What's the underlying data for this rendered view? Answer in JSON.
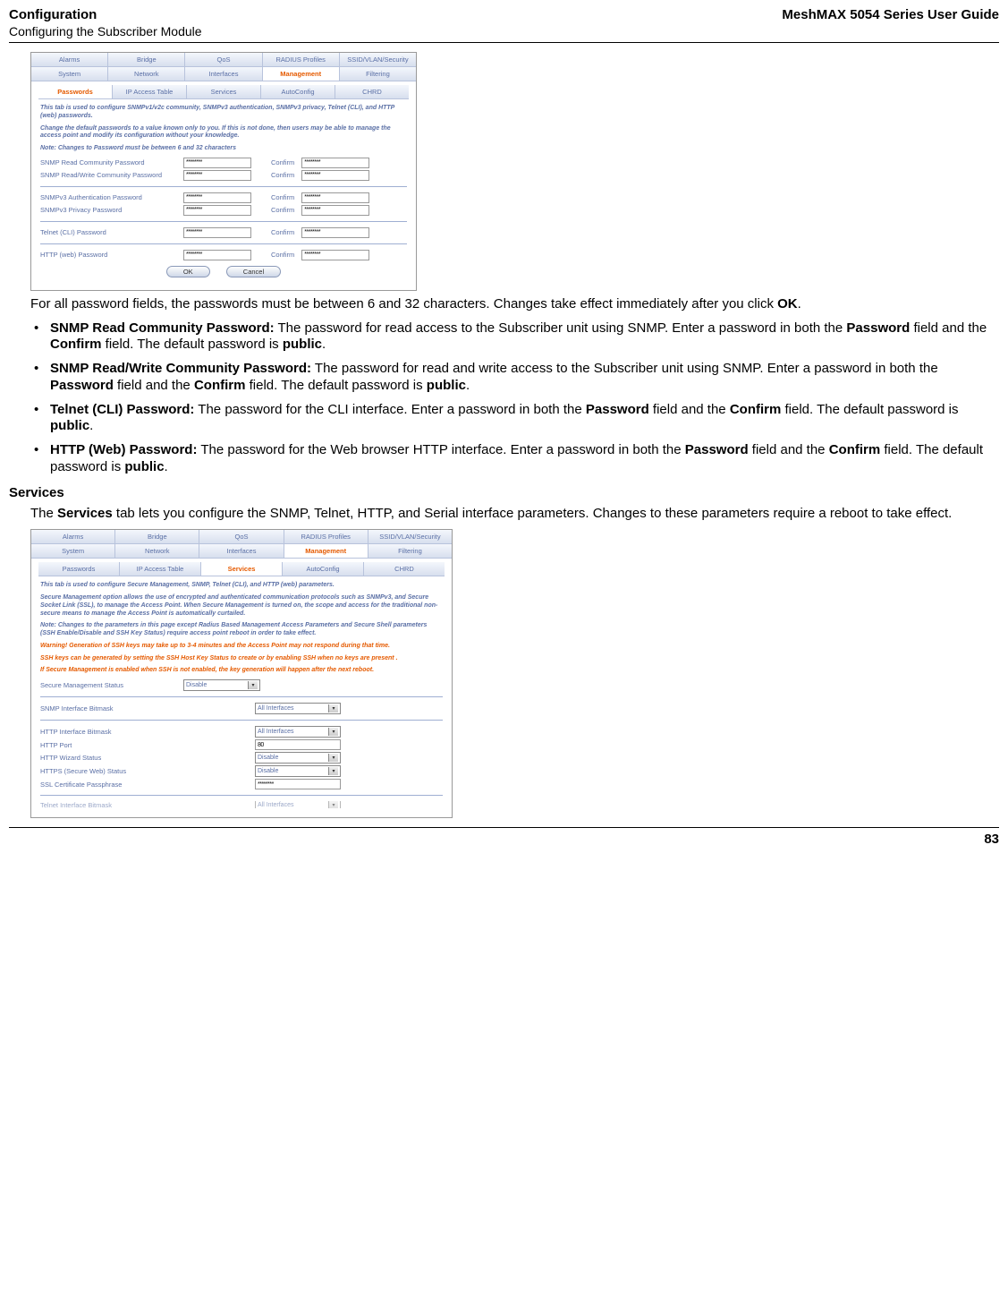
{
  "header": {
    "title_left": "Configuration",
    "sub_left": "Configuring the Subscriber Module",
    "title_right": "MeshMAX 5054 Series User Guide"
  },
  "shot1": {
    "tabs_top": [
      "Alarms",
      "Bridge",
      "QoS",
      "RADIUS Profiles",
      "SSID/VLAN/Security"
    ],
    "tabs_mid": [
      "System",
      "Network",
      "Interfaces",
      "Management",
      "Filtering"
    ],
    "tabs_sub": [
      "Passwords",
      "IP Access Table",
      "Services",
      "AutoConfig",
      "CHRD"
    ],
    "active_mid": "Management",
    "active_sub": "Passwords",
    "desc1": "This tab is used to configure SNMPv1/v2c community, SNMPv3 authentication, SNMPv3 privacy, Telnet (CLI), and HTTP (web) passwords.",
    "desc2": "Change the default passwords to a value known only to you. If this is not done, then users may be able to manage the access point and modify its configuration without your knowledge.",
    "desc3": "Note: Changes to Password must be between 6 and 32 characters",
    "rows": [
      {
        "label": "SNMP Read Community Password",
        "val": "********",
        "confirm": "Confirm",
        "cval": "********"
      },
      {
        "label": "SNMP Read/Write Community Password",
        "val": "********",
        "confirm": "Confirm",
        "cval": "********"
      }
    ],
    "rows2": [
      {
        "label": "SNMPv3 Authentication Password",
        "val": "********",
        "confirm": "Confirm",
        "cval": "********"
      },
      {
        "label": "SNMPv3 Privacy Password",
        "val": "********",
        "confirm": "Confirm",
        "cval": "********"
      }
    ],
    "rows3": [
      {
        "label": "Telnet (CLI) Password",
        "val": "********",
        "confirm": "Confirm",
        "cval": "********"
      }
    ],
    "rows4": [
      {
        "label": "HTTP (web) Password",
        "val": "********",
        "confirm": "Confirm",
        "cval": "********"
      }
    ],
    "ok": "OK",
    "cancel": "Cancel"
  },
  "para1_a": "For all password fields, the passwords must be between 6 and 32 characters. Changes take effect immediately after you click ",
  "para1_b": "OK",
  "para1_c": ".",
  "bullets": [
    {
      "lead": "SNMP Read Community Password:",
      "rest": " The password for read access to the Subscriber unit using SNMP. Enter a password in both the ",
      "b1": "Password",
      "mid1": " field and the ",
      "b2": "Confirm",
      "mid2": " field. The default password is ",
      "b3": "public",
      "end": "."
    },
    {
      "lead": "SNMP Read/Write Community Password:",
      "rest": " The password for read and write access to the Subscriber unit using SNMP. Enter a password in both the ",
      "b1": "Password",
      "mid1": " field and the ",
      "b2": "Confirm",
      "mid2": " field. The default password is ",
      "b3": "public",
      "end": "."
    },
    {
      "lead": "Telnet (CLI) Password:",
      "rest": " The password for the CLI interface. Enter a password in both the ",
      "b1": "Password",
      "mid1": " field and the ",
      "b2": "Confirm",
      "mid2": " field. The default password is ",
      "b3": "public",
      "end": "."
    },
    {
      "lead": "HTTP (Web) Password:",
      "rest": " The password for the Web browser HTTP interface. Enter a password in both the ",
      "b1": "Password",
      "mid1": " field and the ",
      "b2": "Confirm",
      "mid2": " field. The default password is ",
      "b3": "public",
      "end": "."
    }
  ],
  "services_head": "Services",
  "services_para_a": "The ",
  "services_para_b": "Services",
  "services_para_c": " tab lets you configure the SNMP, Telnet, HTTP, and Serial interface parameters. Changes to these parameters require a reboot to take effect.",
  "shot2": {
    "tabs_top": [
      "Alarms",
      "Bridge",
      "QoS",
      "RADIUS Profiles",
      "SSID/VLAN/Security"
    ],
    "tabs_mid": [
      "System",
      "Network",
      "Interfaces",
      "Management",
      "Filtering"
    ],
    "tabs_sub": [
      "Passwords",
      "IP Access Table",
      "Services",
      "AutoConfig",
      "CHRD"
    ],
    "active_mid": "Management",
    "active_sub": "Services",
    "desc1": "This tab is used to configure Secure Management, SNMP, Telnet (CLI), and HTTP (web) parameters.",
    "desc2": "Secure Management option allows the use of encrypted and authenticated communication protocols such as SNMPv3, and Secure Socket Link (SSL), to manage the Access Point. When Secure Management is turned on, the scope and access for the traditional non-secure means to manage the Access Point is automatically curtailed.",
    "desc3": "Note: Changes to the parameters in this page except Radius Based Management Access Parameters and Secure Shell parameters (SSH Enable/Disable and SSH Key Status) require access point reboot in order to take effect.",
    "warn1": "Warning! Generation of SSH keys may take up to 3-4 minutes and the Access Point may not respond during that time.",
    "warn2": "SSH keys can be generated by setting the SSH Host Key Status to create or by enabling SSH when no keys are present .",
    "warn3": "If Secure Management is enabled when SSH is not enabled, the key generation will happen after the next reboot.",
    "rowA": {
      "label": "Secure Management Status",
      "val": "Disable"
    },
    "rowB": {
      "label": "SNMP Interface Bitmask",
      "val": "All Interfaces"
    },
    "http_rows": [
      {
        "label": "HTTP Interface Bitmask",
        "val": "All Interfaces",
        "type": "sel"
      },
      {
        "label": "HTTP Port",
        "val": "80",
        "type": "input"
      },
      {
        "label": "HTTP Wizard Status",
        "val": "Disable",
        "type": "sel"
      },
      {
        "label": "HTTPS (Secure Web) Status",
        "val": "Disable",
        "type": "sel"
      },
      {
        "label": "SSL Certificate Passphrase",
        "val": "********",
        "type": "input"
      }
    ],
    "telnet_label": "Telnet Interface Bitmask",
    "telnet_val": "All Interfaces"
  },
  "page_num": "83"
}
